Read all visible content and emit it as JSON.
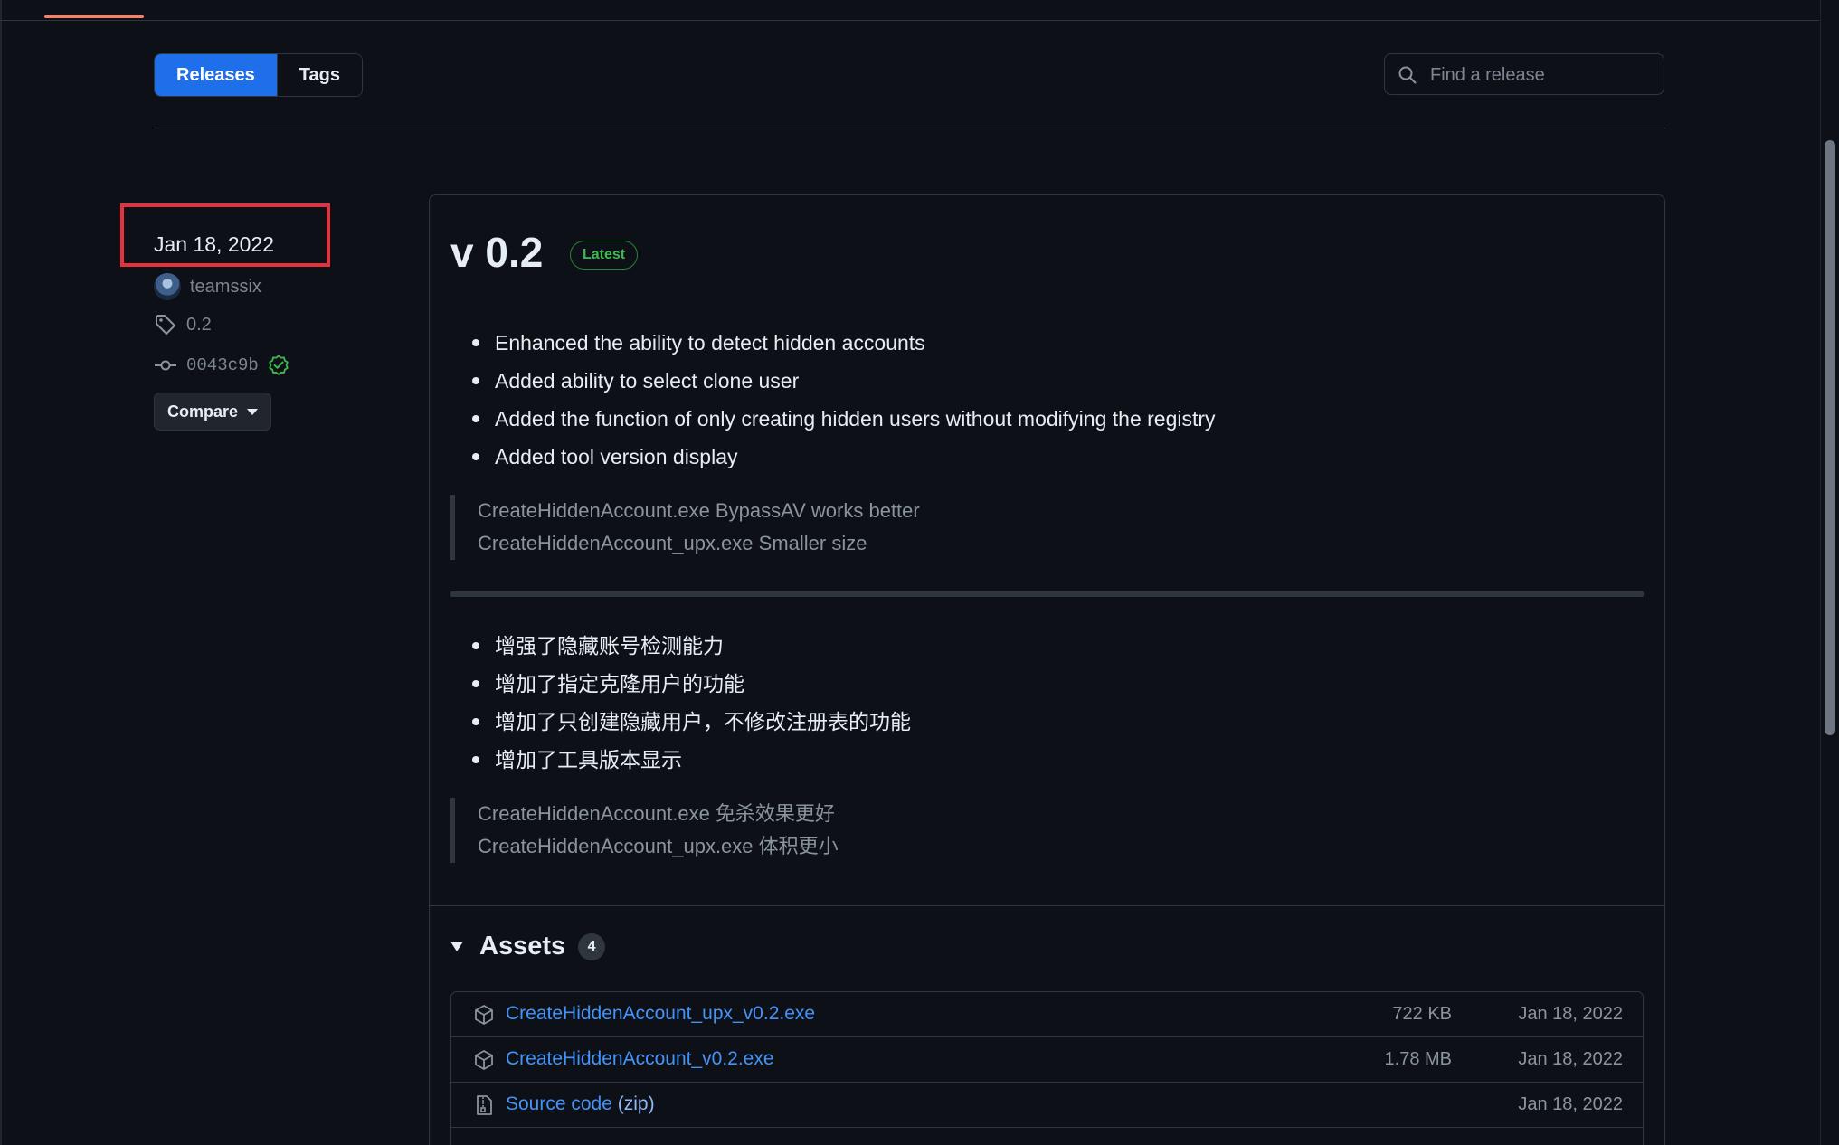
{
  "tabs": {
    "releases_label": "Releases",
    "tags_label": "Tags"
  },
  "search": {
    "placeholder": "Find a release"
  },
  "release": {
    "date": "Jan 18, 2022",
    "author": "teamssix",
    "tag": "0.2",
    "commit": "0043c9b",
    "compare_label": "Compare",
    "title": "v 0.2",
    "badge": "Latest",
    "notes_en": [
      "Enhanced the ability to detect hidden accounts",
      "Added ability to select clone user",
      "Added the function of only creating hidden users without modifying the registry",
      "Added tool version display"
    ],
    "quote_en": [
      "CreateHiddenAccount.exe BypassAV works better",
      "CreateHiddenAccount_upx.exe Smaller size"
    ],
    "notes_zh": [
      "增强了隐藏账号检测能力",
      "增加了指定克隆用户的功能",
      "增加了只创建隐藏用户，不修改注册表的功能",
      "增加了工具版本显示"
    ],
    "quote_zh": [
      "CreateHiddenAccount.exe 免杀效果更好",
      "CreateHiddenAccount_upx.exe 体积更小"
    ]
  },
  "assets": {
    "title": "Assets",
    "count": "4",
    "items": [
      {
        "name": "CreateHiddenAccount_upx_v0.2.exe",
        "suffix": "",
        "size": "722 KB",
        "date": "Jan 18, 2022",
        "icon": "package-icon"
      },
      {
        "name": "CreateHiddenAccount_v0.2.exe",
        "suffix": "",
        "size": "1.78 MB",
        "date": "Jan 18, 2022",
        "icon": "package-icon"
      },
      {
        "name": "Source code",
        "suffix": "(zip)",
        "size": "",
        "date": "Jan 18, 2022",
        "icon": "file-zip-icon"
      }
    ]
  },
  "colors": {
    "background": "#0d1117",
    "accent_blue": "#1f6feb",
    "link": "#4493f8",
    "latest_green": "#3fb950",
    "highlight_red": "#e5323e"
  }
}
